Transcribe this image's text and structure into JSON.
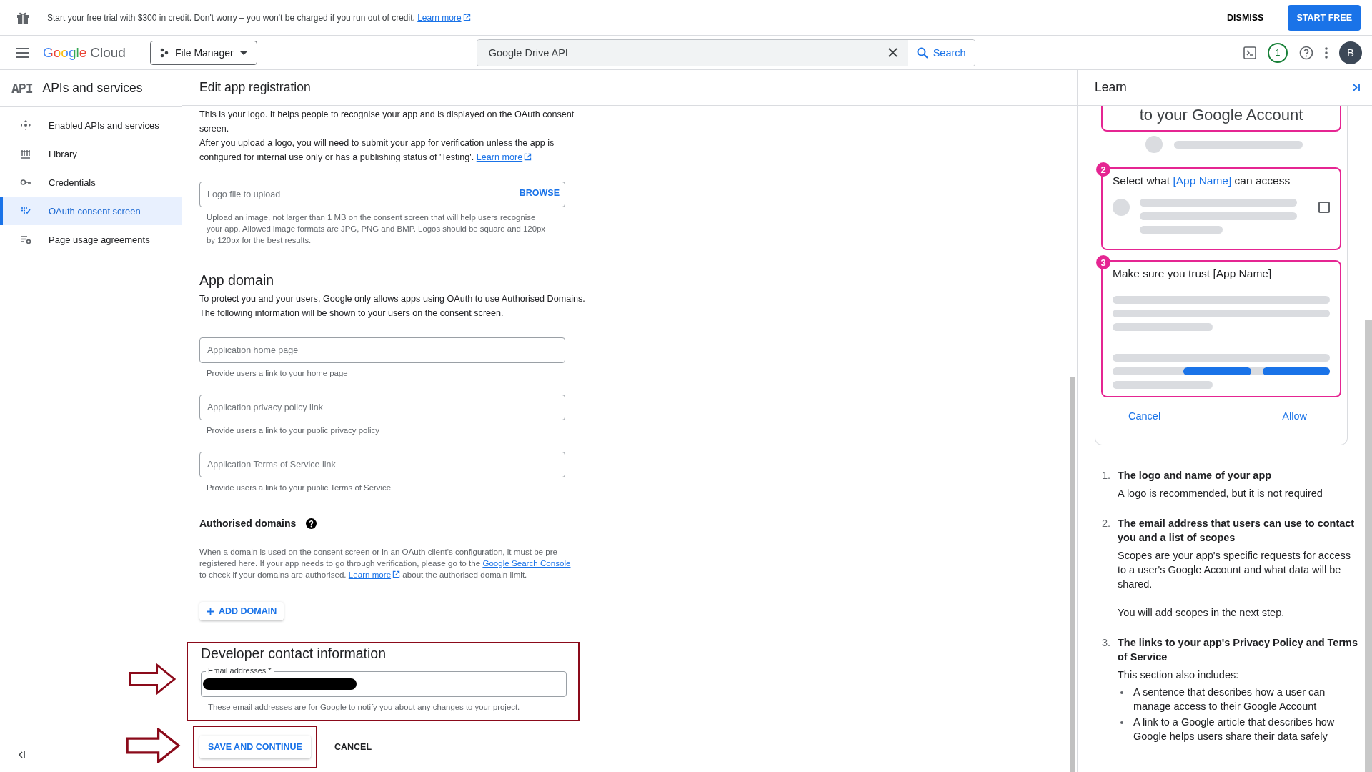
{
  "banner": {
    "text": "Start your free trial with $300 in credit. Don't worry – you won't be charged if you run out of credit.",
    "link": "Learn more",
    "dismiss": "DISMISS",
    "start": "START FREE"
  },
  "header": {
    "brand": "Google",
    "product": "Cloud",
    "project": "File Manager",
    "search": {
      "value": "Google Drive API",
      "button": "Search"
    },
    "notifications": "1",
    "avatar": "B"
  },
  "sidebar": {
    "badge": "API",
    "title": "APIs and services",
    "items": [
      {
        "label": "Enabled APIs and services",
        "selected": false
      },
      {
        "label": "Library",
        "selected": false
      },
      {
        "label": "Credentials",
        "selected": false
      },
      {
        "label": "OAuth consent screen",
        "selected": true
      },
      {
        "label": "Page usage agreements",
        "selected": false
      }
    ]
  },
  "main": {
    "title": "Edit app registration",
    "logo_text": "This is your logo. It helps people to recognise your app and is displayed on the OAuth consent screen.",
    "logo_text_2": {
      "text": "After you upload a logo, you will need to submit your app for verification unless the app is configured for internal use only or has a publishing status of 'Testing'. ",
      "link": "Learn more"
    },
    "logo_field": {
      "placeholder": "Logo file to upload",
      "button": "BROWSE",
      "hint": "Upload an image, not larger than 1 MB on the consent screen that will help users recognise your app. Allowed image formats are JPG, PNG and BMP. Logos should be square and 120px by 120px for the best results."
    },
    "app_domain": {
      "heading": "App domain",
      "text": "To protect you and your users, Google only allows apps using OAuth to use Authorised Domains. The following information will be shown to your users on the consent screen.",
      "fields": [
        {
          "placeholder": "Application home page",
          "hint": "Provide users a link to your home page"
        },
        {
          "placeholder": "Application privacy policy link",
          "hint": "Provide users a link to your public privacy policy"
        },
        {
          "placeholder": "Application Terms of Service link",
          "hint": "Provide users a link to your public Terms of Service"
        }
      ]
    },
    "authorised": {
      "heading": "Authorised domains",
      "parts": [
        {
          "kind": "text",
          "text": "When a domain is used on the consent screen or in an OAuth client's configuration, it must be pre-registered here. If your app needs to go through verification, please go to the "
        },
        {
          "kind": "link",
          "text": "Google Search Console"
        },
        {
          "kind": "text",
          "text": " to check if your domains are authorised. "
        },
        {
          "kind": "external",
          "text": "Learn more"
        },
        {
          "kind": "text",
          "text": " about the authorised domain limit."
        }
      ],
      "button": "ADD DOMAIN"
    },
    "developer": {
      "heading": "Developer contact information",
      "label": "Email addresses *",
      "redacted": true,
      "hint": "These email addresses are for Google to notify you about any changes to your project.",
      "highlighted": true
    },
    "actions": {
      "save": "SAVE AND CONTINUE",
      "cancel": "CANCEL",
      "highlighted": true
    }
  },
  "learn": {
    "title": "Learn",
    "preview": {
      "top_text": "to your Google Account",
      "step2": {
        "number": "2",
        "before": "Select what ",
        "highlight": "[App Name]",
        "after": " can access",
        "checked": false
      },
      "step3": {
        "number": "3",
        "text": "Make sure you trust [App Name]"
      },
      "cancel": "Cancel",
      "allow": "Allow"
    },
    "items": [
      {
        "number": "1.",
        "title": "The logo and name of your app",
        "paragraphs": [
          "A logo is recommended, but it is not required"
        ]
      },
      {
        "number": "2.",
        "title": "The email address that users can use to contact you and a list of scopes",
        "paragraphs": [
          "Scopes are your app's specific requests for access to a user's Google Account and what data will be shared.",
          "You will add scopes in the next step."
        ]
      },
      {
        "number": "3.",
        "title": "The links to your app's Privacy Policy and Terms of Service",
        "paragraphs": [
          "This section also includes:"
        ],
        "bullets": [
          "A sentence that describes how a user can manage access to their Google Account",
          "A link to a Google article that describes how Google helps users share their data safely"
        ]
      }
    ]
  }
}
